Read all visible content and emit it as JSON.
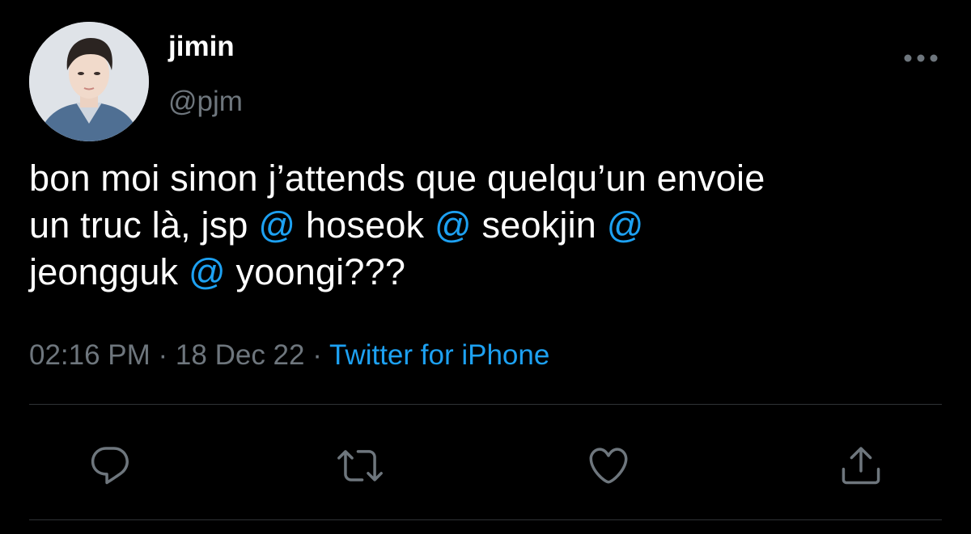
{
  "user": {
    "display_name": "jimin",
    "handle": "@pjm",
    "avatar": "profile-photo"
  },
  "tweet": {
    "lines": [
      [
        {
          "text": "bon moi sinon j’attends que quelqu’un envoie",
          "mention": false
        }
      ],
      [
        {
          "text": "un truc là, jsp ",
          "mention": false
        },
        {
          "text": "@",
          "mention": true
        },
        {
          "text": " hoseok ",
          "mention": false
        },
        {
          "text": "@",
          "mention": true
        },
        {
          "text": " seokjin ",
          "mention": false
        },
        {
          "text": "@",
          "mention": true
        }
      ],
      [
        {
          "text": "jeongguk ",
          "mention": false
        },
        {
          "text": "@",
          "mention": true
        },
        {
          "text": " yoongi???",
          "mention": false
        }
      ]
    ]
  },
  "meta": {
    "time": "02:16 PM",
    "separator": " · ",
    "date": "18 Dec 22",
    "source": "Twitter for iPhone"
  },
  "actions": [
    {
      "name": "reply-button",
      "icon": "reply-icon"
    },
    {
      "name": "retweet-button",
      "icon": "retweet-icon"
    },
    {
      "name": "like-button",
      "icon": "heart-icon"
    },
    {
      "name": "share-button",
      "icon": "share-icon"
    }
  ],
  "colors": {
    "background": "#000000",
    "text": "#ffffff",
    "secondary": "#6e767d",
    "accent": "#1da1f2",
    "divider": "#2f3336"
  }
}
